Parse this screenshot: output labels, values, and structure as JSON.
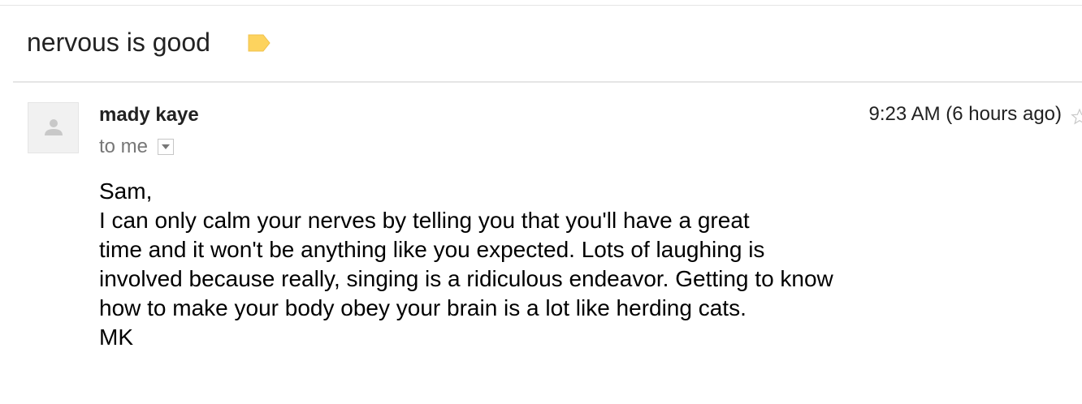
{
  "thread": {
    "subject": "nervous is good",
    "label_color": "#fdd35e",
    "label_icon": "label-tag-icon"
  },
  "message": {
    "avatar_icon": "default-person-icon",
    "sender": "mady kaye",
    "recipient": "to me",
    "details_icon": "chevron-down-icon",
    "timestamp": "9:23 AM (6 hours ago)",
    "star_icon": "star-icon",
    "body_lines": [
      "Sam,",
      "I can only calm your nerves by telling you that you'll have a great",
      "time and it won't be anything like you expected. Lots of laughing is",
      "involved because really, singing is a ridiculous endeavor. Getting to know",
      "how to make your body obey your brain is a lot like herding cats.",
      "MK"
    ]
  }
}
